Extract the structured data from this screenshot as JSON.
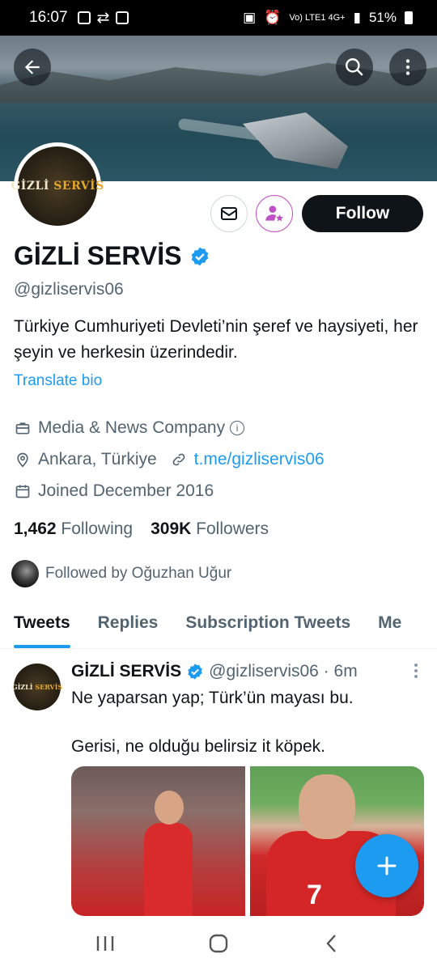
{
  "status_bar": {
    "time": "16:07",
    "network": "Vo) LTE1 4G+",
    "battery": "51%"
  },
  "profile": {
    "name": "GİZLİ SERVİS",
    "handle": "@gizliservis06",
    "avatar_text_white": "GİZLİ",
    "avatar_text_gold": "SERVİS",
    "bio": "Türkiye Cumhuriyeti Devleti’nin şeref ve haysiyeti, her şeyin ve herkesin üzerindedir.",
    "translate_label": "Translate bio",
    "category": "Media & News Company",
    "location": "Ankara, Türkiye",
    "link": "t.me/gizliservis06",
    "joined": "Joined December 2016",
    "following_count": "1,462",
    "following_label": "Following",
    "followers_count": "309K",
    "followers_label": "Followers",
    "followed_by": "Followed by Oğuzhan Uğur"
  },
  "actions": {
    "follow_label": "Follow"
  },
  "tabs": [
    {
      "label": "Tweets",
      "active": true
    },
    {
      "label": "Replies",
      "active": false
    },
    {
      "label": "Subscription Tweets",
      "active": false
    },
    {
      "label": "Me",
      "active": false
    }
  ],
  "tweet": {
    "name": "GİZLİ SERVİS",
    "handle_time": "@gizliservis06 · 6m",
    "line1": "Ne yaparsan yap; Türk’ün mayası bu.",
    "line2": "",
    "line3": "Gerisi, ne olduğu belirsiz it köpek.",
    "image2_number": "7"
  },
  "colors": {
    "accent": "#1d9bf0",
    "text": "#0f1419",
    "secondary": "#536471"
  }
}
